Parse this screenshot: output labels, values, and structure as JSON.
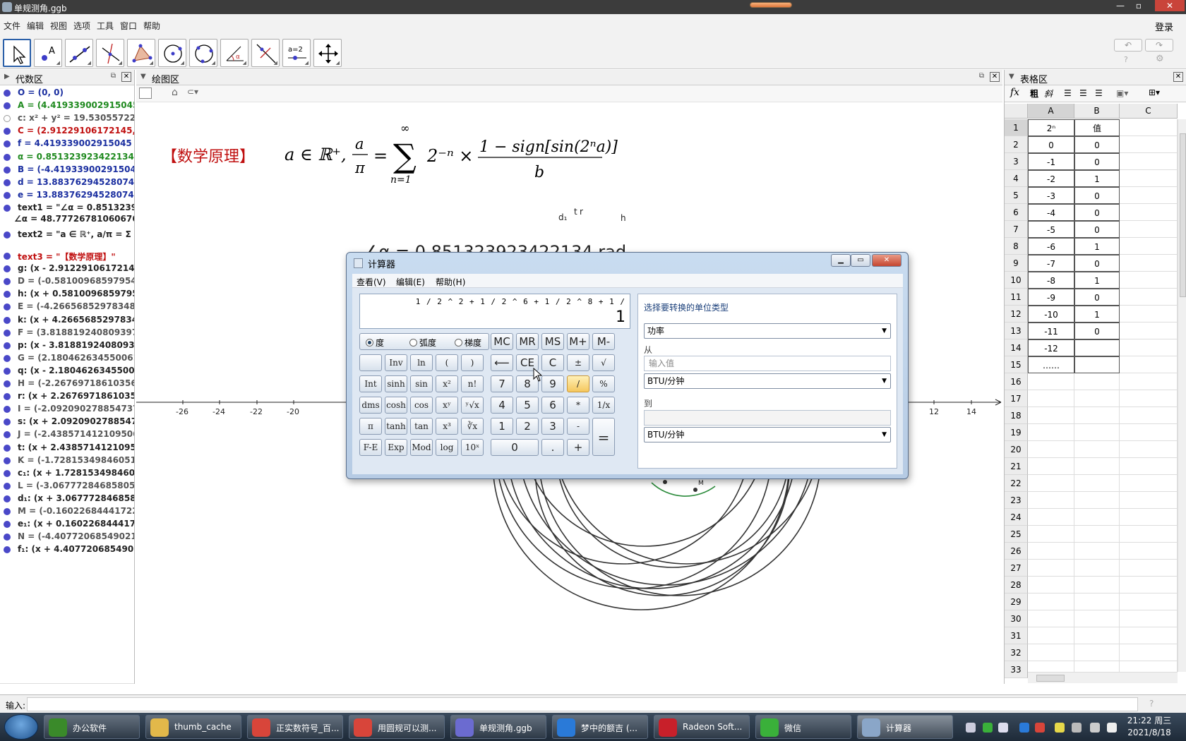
{
  "window": {
    "title": "单规测角.ggb",
    "minimize": "—",
    "maximize": "▫",
    "close": "✕"
  },
  "menu": [
    "文件",
    "编辑",
    "视图",
    "选项",
    "工具",
    "窗口",
    "帮助"
  ],
  "login": "登录",
  "toolbar": {
    "tool8_label": "a=2",
    "undo": "↶",
    "redo": "↷"
  },
  "algebra": {
    "title": "代数区",
    "items": [
      {
        "text": "O = (0, 0)",
        "color": "blue"
      },
      {
        "text": "A = (4.419339002915045, 0)",
        "color": "green"
      },
      {
        "text": "c: x² + y² = 19.530557222686614",
        "color": "grey",
        "hollow": true
      },
      {
        "text": "C = (2.91229106172145, 3.3240",
        "color": "red"
      },
      {
        "text": "f = 4.419339002915045",
        "color": "blue"
      },
      {
        "text": "α = 0.851323923422134 rad",
        "color": "green"
      },
      {
        "text": "B = (-4.419339002915045, 0)",
        "color": "blue"
      },
      {
        "text": "d = 13.883762945280747",
        "color": "blue"
      },
      {
        "text": "e = 13.883762945280747",
        "color": "blue"
      },
      {
        "text": "text1 = \"∠α = 0.8513239",
        "color": "dark"
      },
      {
        "text": "∠α = 48.7772678106067669",
        "color": "dark"
      },
      {
        "text": "text2 = \"a ∈ ℝ⁺, a/π = Σ",
        "color": "dark"
      },
      {
        "text": "text3 = \"【数学原理】\"",
        "color": "red"
      },
      {
        "text": "g: (x - 2.91229106172145)² + (y",
        "color": "dark"
      },
      {
        "text": "D = (-0.581009685979549, 4.38",
        "color": "grey"
      },
      {
        "text": "h: (x + 0.581009685979549)² +",
        "color": "dark"
      },
      {
        "text": "E = (-4.266568529783481, -1.1",
        "color": "grey"
      },
      {
        "text": "k: (x + 4.266568529783481)² +",
        "color": "dark"
      },
      {
        "text": "F = (3.818819240809397, 2.224",
        "color": "grey"
      },
      {
        "text": "p: (x - 3.818819240809397)² + (",
        "color": "dark"
      },
      {
        "text": "G = (2.180462634550061, 3.843",
        "color": "grey"
      },
      {
        "text": "q: (x - 2.180462634550061)² + (",
        "color": "dark"
      },
      {
        "text": "H = (-2.26769718610356, 3.793",
        "color": "grey"
      },
      {
        "text": "r: (x + 2.26769718610356)² + (y",
        "color": "dark"
      },
      {
        "text": "I = (-2.092090278854737, -3.89",
        "color": "grey"
      },
      {
        "text": "s: (x + 2.092090278854737)² +",
        "color": "dark"
      },
      {
        "text": "J = (-2.438571412109506, 3.68",
        "color": "grey"
      },
      {
        "text": "t: (x + 2.438571412109506)² + (",
        "color": "dark"
      },
      {
        "text": "K = (-1.728153498460515, -4.0",
        "color": "grey"
      },
      {
        "text": "c₁: (x + 1.728153498460515)² +",
        "color": "dark"
      },
      {
        "text": "L = (-3.067772846858052, 3.18",
        "color": "grey"
      },
      {
        "text": "d₁: (x + 3.067772846858052)² +",
        "color": "dark"
      },
      {
        "text": "M = (-0.160226844417223, -4.4",
        "color": "grey"
      },
      {
        "text": "e₁: (x + 0.160226844417223)² +",
        "color": "dark"
      },
      {
        "text": "N = (-4.407720685490215, 0.32",
        "color": "grey"
      },
      {
        "text": "f₁: (x + 4.407720685490215)² +",
        "color": "dark"
      }
    ]
  },
  "graphics": {
    "title": "绘图区",
    "principle_label": "【数学原理】",
    "formula": {
      "lhs": "a ∈ ℝ⁺,",
      "frac_num": "a",
      "frac_den": "π",
      "equals": "=",
      "sum_top": "∞",
      "sum_bottom": "n=1",
      "term": "2⁻ⁿ ×",
      "num": "1 − sign[sin(2ⁿa)]",
      "den": "b"
    },
    "angle_text": "∠α = 0.851323923422134 rad",
    "point_labels": [
      "d₁",
      "t",
      "r",
      "h",
      "M"
    ],
    "axis_ticks_left": [
      "-26",
      "-24",
      "-22",
      "-20"
    ],
    "axis_ticks_right": [
      "12",
      "14"
    ]
  },
  "calculator": {
    "title": "计算器",
    "menu": [
      "查看(V)",
      "编辑(E)",
      "帮助(H)"
    ],
    "expression": "1 / 2 ^ 2 + 1 / 2 ^ 6 + 1 / 2 ^ 8 + 1 /",
    "result": "1",
    "angle_modes": [
      "度",
      "弧度",
      "梯度"
    ],
    "memory": [
      "MC",
      "MR",
      "MS",
      "M+",
      "M-"
    ],
    "row1": [
      "",
      "Inv",
      "ln",
      "(",
      ")",
      "⟵",
      "CE",
      "C",
      "±",
      "√"
    ],
    "row2": [
      "Int",
      "sinh",
      "sin",
      "x²",
      "n!",
      "7",
      "8",
      "9",
      "/",
      "%"
    ],
    "row3": [
      "dms",
      "cosh",
      "cos",
      "xʸ",
      "ʸ√x",
      "4",
      "5",
      "6",
      "*",
      "1/x"
    ],
    "row4": [
      "π",
      "tanh",
      "tan",
      "x³",
      "∛x",
      "1",
      "2",
      "3",
      "-",
      "="
    ],
    "row5": [
      "F-E",
      "Exp",
      "Mod",
      "log",
      "10ˣ",
      "0",
      ".",
      "+"
    ],
    "unit": {
      "prompt": "选择要转换的单位类型",
      "type": "功率",
      "from_label": "从",
      "from_placeholder": "输入值",
      "from_unit": "BTU/分钟",
      "to_label": "到",
      "to_unit": "BTU/分钟"
    }
  },
  "spreadsheet": {
    "title": "表格区",
    "columns": [
      "A",
      "B",
      "C"
    ],
    "rows": [
      [
        "2ⁿ",
        "值"
      ],
      [
        "0",
        "0"
      ],
      [
        "-1",
        "0"
      ],
      [
        "-2",
        "1"
      ],
      [
        "-3",
        "0"
      ],
      [
        "-4",
        "0"
      ],
      [
        "-5",
        "0"
      ],
      [
        "-6",
        "1"
      ],
      [
        "-7",
        "0"
      ],
      [
        "-8",
        "1"
      ],
      [
        "-9",
        "0"
      ],
      [
        "-10",
        "1"
      ],
      [
        "-11",
        "0"
      ],
      [
        "-12",
        ""
      ],
      [
        "……",
        ""
      ]
    ],
    "row_numbers": [
      "1",
      "2",
      "3",
      "4",
      "5",
      "6",
      "7",
      "8",
      "9",
      "10",
      "11",
      "12",
      "13",
      "14",
      "15",
      "16",
      "17",
      "18",
      "19",
      "20",
      "21",
      "22",
      "23",
      "24",
      "25",
      "26",
      "27",
      "28",
      "29",
      "30",
      "31",
      "32",
      "33"
    ]
  },
  "inputbar": {
    "label": "输入:"
  },
  "taskbar": {
    "tasks": [
      {
        "label": "办公软件",
        "color": "#3a8a2a"
      },
      {
        "label": "thumb_cache",
        "color": "#e2b84a"
      },
      {
        "label": "正实数符号_百...",
        "color": "#d8453a"
      },
      {
        "label": "用圆规可以测...",
        "color": "#d8453a"
      },
      {
        "label": "单规测角.ggb",
        "color": "#6b6bd0"
      },
      {
        "label": "梦中的额吉 (...",
        "color": "#2a7ad8"
      },
      {
        "label": "Radeon Soft...",
        "color": "#c8202a"
      },
      {
        "label": "微信",
        "color": "#3ab03a"
      },
      {
        "label": "计算器",
        "color": "#8aa6c8"
      }
    ],
    "time": "21:22 周三",
    "date": "2021/8/18"
  }
}
